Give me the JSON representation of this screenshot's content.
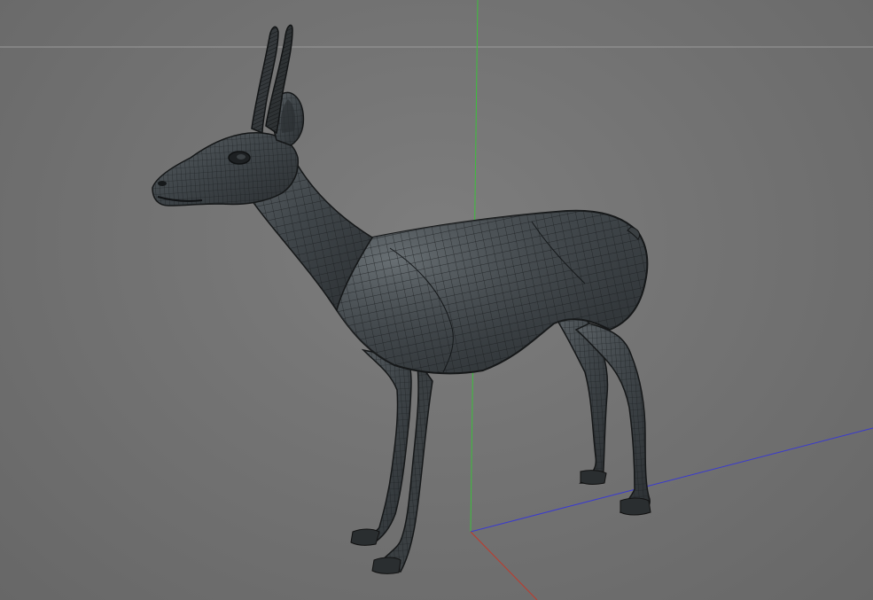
{
  "viewport": {
    "background": "#727272",
    "horizon_line_color": "#9a9a9a"
  },
  "axes": {
    "y_axis_color": "#3cbf3c",
    "z_axis_color": "#3a3acf",
    "x_axis_color": "#c0392b"
  },
  "model": {
    "name": "gazelle-wireframe-mesh",
    "surface_color": "#3e4346",
    "wire_color": "#1b1e20",
    "shading": "wireframe-on-shaded"
  }
}
